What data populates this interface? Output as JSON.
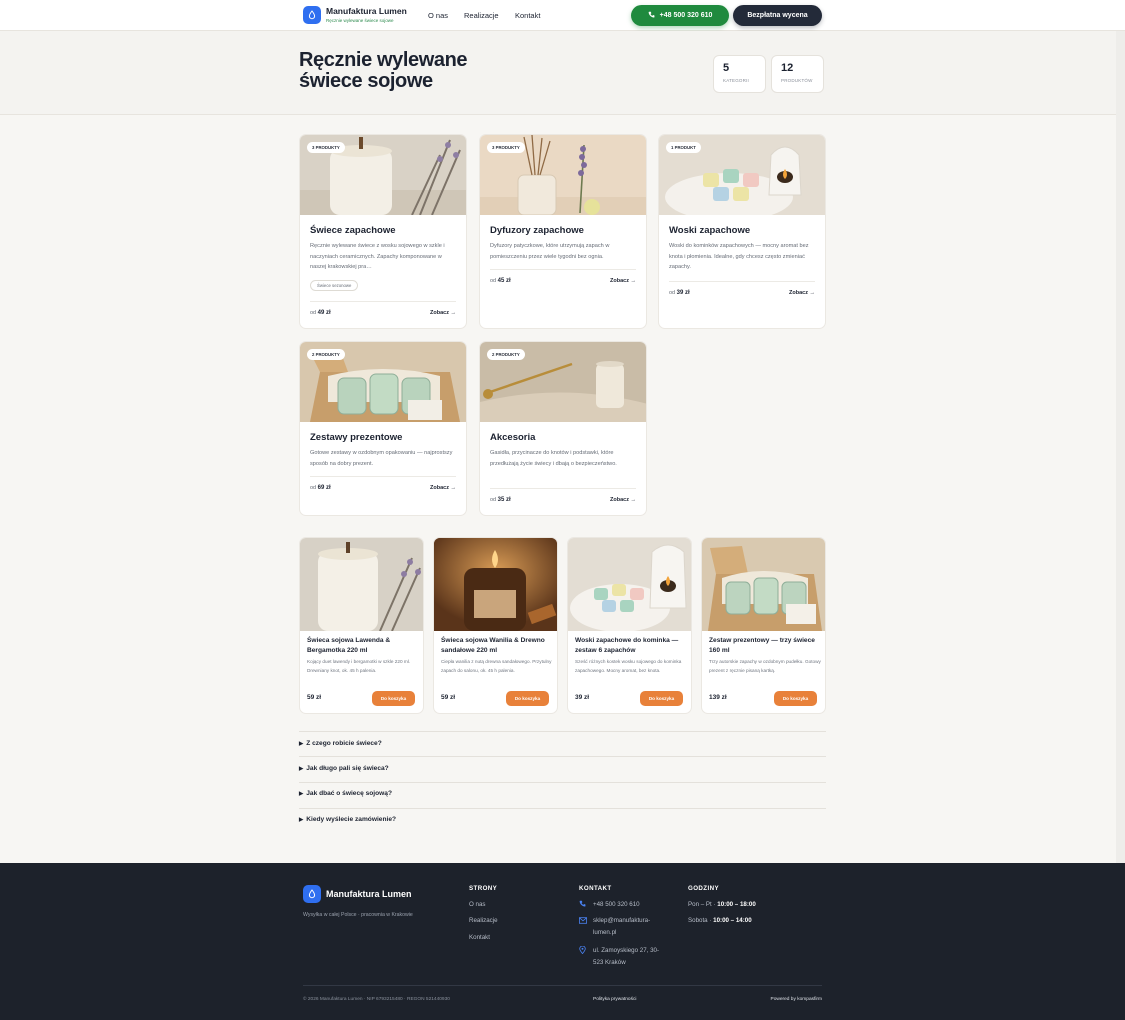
{
  "header": {
    "brand": "Manufaktura Lumen",
    "tagline": "Ręcznie wylewane świece sojowe",
    "nav": [
      "O nas",
      "Realizacje",
      "Kontakt"
    ],
    "phone_button": "+48 500 320 610",
    "quote_button": "Bezpłatna wycena"
  },
  "hero": {
    "title": "Ręcznie wylewane świece sojowe",
    "stats": [
      {
        "value": "5",
        "label": "KATEGORII"
      },
      {
        "value": "12",
        "label": "PRODUKTÓW"
      }
    ]
  },
  "categories": [
    {
      "badge": "3 PRODUKTY",
      "title": "Świece zapachowe",
      "desc": "Ręcznie wylewane świece z wosku sojowego w szkle i naczyniach ceramicznych. Zapachy komponowane w naszej krakowskiej pra…",
      "chip": "Świece sezonowe",
      "price_prefix": "od",
      "price": "49 zł",
      "link": "Zobacz →"
    },
    {
      "badge": "3 PRODUKTY",
      "title": "Dyfuzory zapachowe",
      "desc": "Dyfuzory patyczkowe, które utrzymują zapach w pomieszczeniu przez wiele tygodni bez ognia.",
      "price_prefix": "od",
      "price": "45 zł",
      "link": "Zobacz →"
    },
    {
      "badge": "1 PRODUKT",
      "title": "Woski zapachowe",
      "desc": "Woski do kominków zapachowych — mocny aromat bez knota i płomienia. Idealne, gdy chcesz często zmieniać zapachy.",
      "price_prefix": "od",
      "price": "39 zł",
      "link": "Zobacz →"
    },
    {
      "badge": "2 PRODUKTY",
      "title": "Zestawy prezentowe",
      "desc": "Gotowe zestawy w ozdobnym opakowaniu — najprostszy sposób na dobry prezent.",
      "price_prefix": "od",
      "price": "69 zł",
      "link": "Zobacz →"
    },
    {
      "badge": "2 PRODUKTY",
      "title": "Akcesoria",
      "desc": "Gasidła, przycinacze do knotów i podstawki, które przedłużają życie świecy i dbają o bezpieczeństwo.",
      "price_prefix": "od",
      "price": "35 zł",
      "link": "Zobacz →"
    }
  ],
  "products": [
    {
      "title": "Świeca sojowa Lawenda & Bergamotka 220 ml",
      "desc": "Kojący duet lawendy i bergamotki w szkle 220 ml. Drewniany knot, ok. 45 h palenia.",
      "price": "59 zł",
      "button": "Do koszyka"
    },
    {
      "title": "Świeca sojowa Wanilia & Drewno sandałowe 220 ml",
      "desc": "Ciepła wanilia z nutą drewna sandałowego. Przytulny zapach do salonu, ok. 45 h palenia.",
      "price": "59 zł",
      "button": "Do koszyka"
    },
    {
      "title": "Woski zapachowe do kominka — zestaw 6 zapachów",
      "desc": "Sześć różnych kostek wosku sojowego do kominka zapachowego. Mocny aromat, bez knota.",
      "price": "39 zł",
      "button": "Do koszyka"
    },
    {
      "title": "Zestaw prezentowy — trzy świece 160 ml",
      "desc": "Trzy autorskie zapachy w ozdobnym pudełku. Gotowy prezent z ręcznie pisaną kartką.",
      "price": "139 zł",
      "button": "Do koszyka"
    }
  ],
  "faq": [
    "Z czego robicie świece?",
    "Jak długo pali się świeca?",
    "Jak dbać o świecę sojową?",
    "Kiedy wyślecie zamówienie?"
  ],
  "footer": {
    "brand": "Manufaktura Lumen",
    "tagline": "Wysyłka w całej Polsce · pracownia w Krakowie",
    "pages_heading": "STRONY",
    "pages": [
      "O nas",
      "Realizacje",
      "Kontakt"
    ],
    "contact_heading": "KONTAKT",
    "phone": "+48 500 320 610",
    "email_line1": "sklep@manufaktura-",
    "email_line2": "lumen.pl",
    "address_line1": "ul. Zamoyskiego 27, 30-",
    "address_line2": "523 Kraków",
    "hours_heading": "GODZINY",
    "hours": [
      {
        "days": "Pon – Pt ·",
        "time": "10:00 – 18:00"
      },
      {
        "days": "Sobota ·",
        "time": "10:00 – 14:00"
      }
    ],
    "legal": "© 2026 Manufaktura Lumen · NIP 6793215480 · REGON 521440930",
    "privacy": "Polityka prywatności",
    "powered": "Powered by kompasfirm"
  },
  "colors": {
    "accent_blue": "#2f6ff0",
    "phone_green": "#1f8a3e",
    "cart_orange": "#e8813a",
    "footer_bg": "#1d222b"
  },
  "icons": [
    "candle-drop-icon",
    "phone-icon",
    "mail-icon",
    "pin-icon",
    "caret-right-icon"
  ]
}
